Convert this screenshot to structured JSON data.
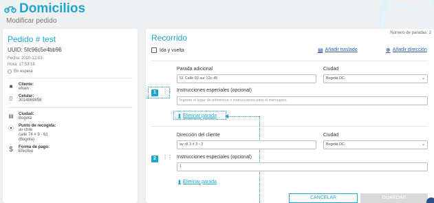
{
  "header": {
    "title": "Domicilios",
    "subtitle": "Modificar pedido"
  },
  "order": {
    "title": "Pedido # test",
    "uuid": "UUID: 5fc96c5e4bb96",
    "date": "Fecha: 2020-12-03",
    "time": "Hora: 17:53:18",
    "status": "En espera",
    "client_label": "Cliente:",
    "client_value": "efrain",
    "phone_label": "Celular:",
    "phone_value": "3014869858",
    "city_label": "Ciudad:",
    "city_value": "Bogota",
    "pickup_label": "Punto de recogida:",
    "pickup_line1": "av chile",
    "pickup_line2": "calle 74 # 9 - 61",
    "pickup_line3": "(Bogota)",
    "payment_label": "Forma de pago:",
    "payment_value": "Efectivo"
  },
  "route": {
    "title": "Recorrido",
    "stops_count": "Número de paradas: 2",
    "round_trip_label": "Ida y vuelta",
    "add_transfer": "Añadir traslado",
    "add_address": "Añadir dirección"
  },
  "stops": [
    {
      "number": "1",
      "address_label": "Parada adicional",
      "address_value": "51 Calle 93 sur 12c-45",
      "city_label": "Ciudad",
      "city_value": "Bogotá DC",
      "instructions_label": "Instrucciones especiales (opcional)",
      "instructions_placeholder": "Ingrese el lugar de referencia o instrucciones para el mensajero.",
      "delete_label": "Eliminar parada"
    },
    {
      "number": "2",
      "address_label": "Dirección del cliente",
      "address_value": "av cll 3 # 3 - 3",
      "city_label": "Ciudad",
      "city_value": "Bogotá DC",
      "instructions_label": "Instrucciones especiales (opcional)",
      "instructions_value": "1",
      "delete_label": "Eliminar parada"
    }
  ],
  "buttons": {
    "cancel": "CANCELAR",
    "save": "GUARDAR"
  },
  "icons": {
    "title": "motorcycle-icon",
    "client": "person-icon",
    "phone": "phone-icon",
    "city": "map-icon",
    "pickup": "compass-icon",
    "payment": "dollar-icon",
    "transfer": "calendar-icon",
    "add": "plus-circle-icon",
    "delete": "trash-icon",
    "drag": "drag-handle-icon"
  },
  "colors": {
    "accent": "#1fa4d0",
    "link": "#2a5b9a"
  }
}
